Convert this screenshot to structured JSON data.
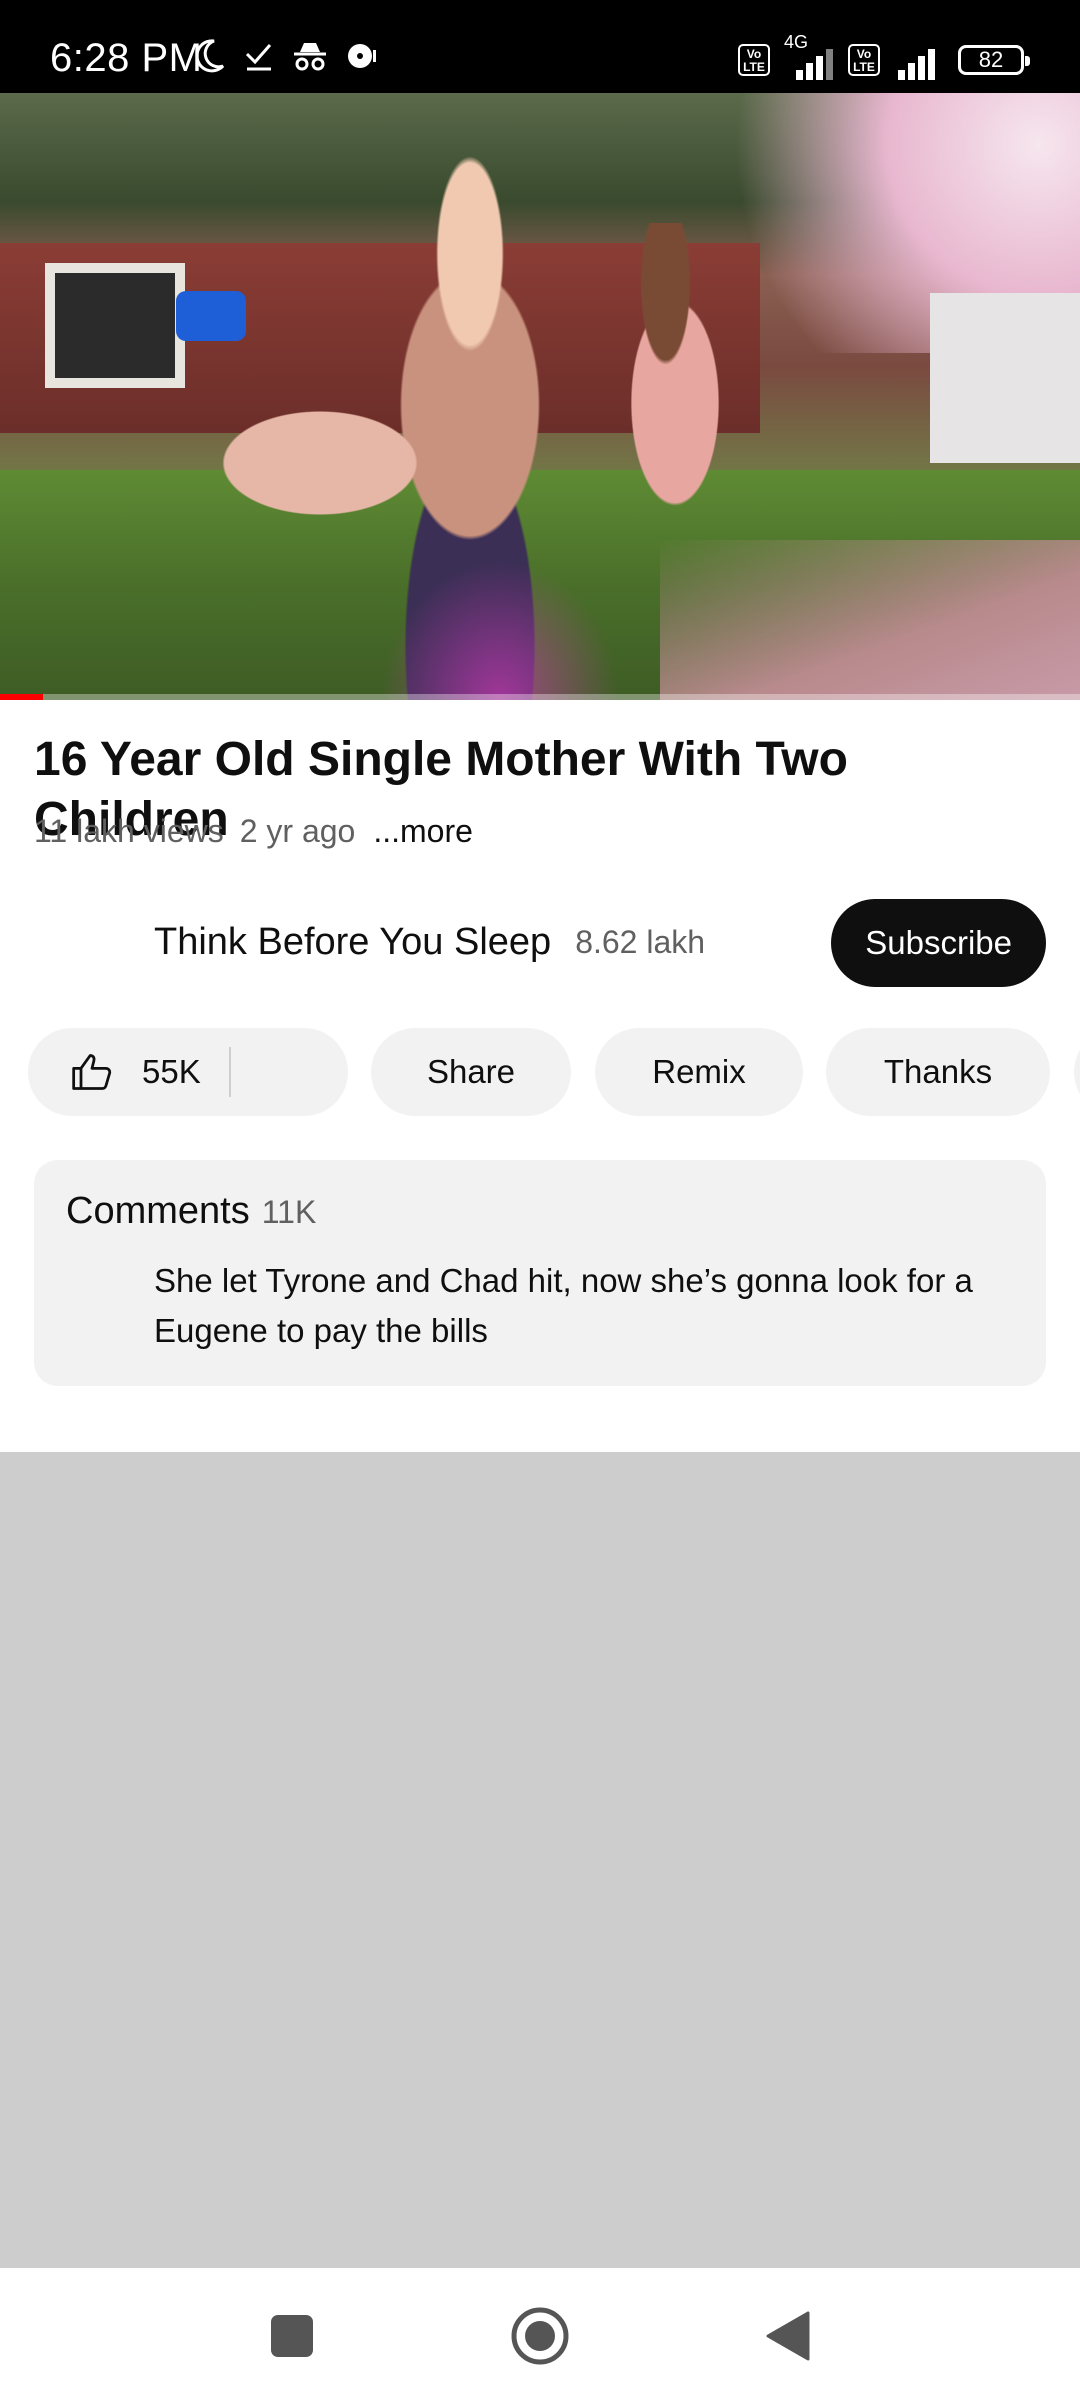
{
  "status_bar": {
    "time": "6:28 PM",
    "net_label": "4G",
    "volte_1": "Vo LTE",
    "volte_2": "Vo LTE",
    "battery": "82"
  },
  "video": {
    "progress_fraction": 0.04,
    "buffer_fraction": 0.04
  },
  "title": "16 Year Old Single Mother With Two Children",
  "meta": {
    "views": "11 lakh views",
    "age": "2 yr ago",
    "more": "...more"
  },
  "channel": {
    "name": "Think Before You Sleep",
    "subscribers": "8.62 lakh",
    "subscribe_label": "Subscribe"
  },
  "actions": {
    "likes": "55K",
    "share": "Share",
    "remix": "Remix",
    "thanks": "Thanks"
  },
  "comments": {
    "title": "Comments",
    "count": "11K",
    "top_comment": "She let Tyrone and Chad hit, now she’s gonna look for a Eugene to pay the bills"
  },
  "colors": {
    "accent": "#ff0000",
    "subscribe_bg": "#0f0f0f",
    "chip_bg": "#f2f2f2",
    "placeholder": "#cdcdcd"
  }
}
